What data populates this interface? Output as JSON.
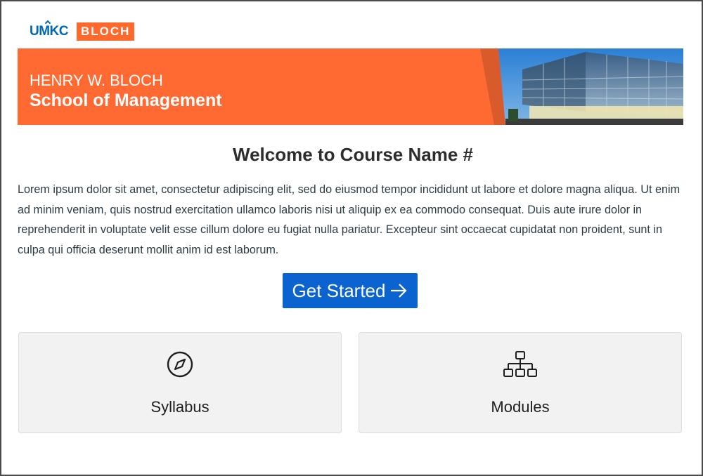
{
  "logos": {
    "umkc": "UMKC",
    "bloch": "BLOCH"
  },
  "banner": {
    "line1": "HENRY W. BLOCH",
    "line2": "School of Management"
  },
  "page": {
    "title": "Welcome to Course Name #",
    "intro": "Lorem ipsum dolor sit amet, consectetur adipiscing elit, sed do eiusmod tempor incididunt ut labore et dolore magna aliqua. Ut enim ad minim veniam, quis nostrud exercitation ullamco laboris nisi ut aliquip ex ea commodo consequat. Duis aute irure dolor in reprehenderit in voluptate velit esse cillum dolore eu fugiat nulla pariatur. Excepteur sint occaecat cupidatat non proident, sunt in culpa qui officia deserunt mollit anim id est laborum."
  },
  "cta": {
    "label": "Get Started",
    "icon": "arrow-right-icon"
  },
  "cards": [
    {
      "label": "Syllabus",
      "icon": "compass-icon"
    },
    {
      "label": "Modules",
      "icon": "sitemap-icon"
    }
  ],
  "colors": {
    "brand_orange": "#ff6a33",
    "brand_blue": "#0067b1",
    "button_blue": "#0a63ce",
    "card_bg": "#f2f2f2"
  }
}
